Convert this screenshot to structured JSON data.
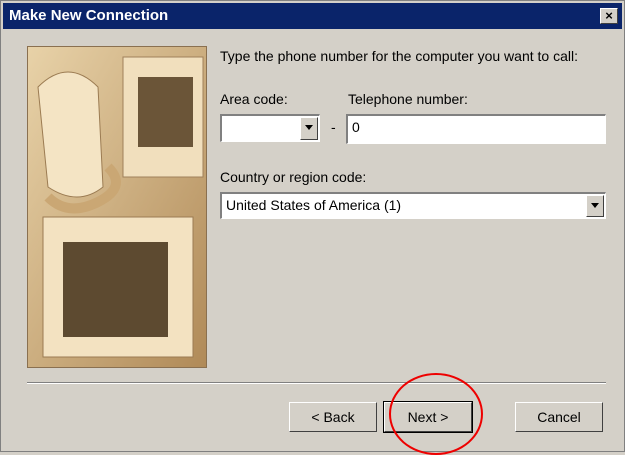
{
  "window": {
    "title": "Make New Connection"
  },
  "instructions": "Type the phone number for the computer you want to call:",
  "area_code": {
    "label": "Area code:",
    "value": ""
  },
  "separator_dash": "-",
  "phone": {
    "label": "Telephone number:",
    "value": "0"
  },
  "country": {
    "label": "Country or region code:",
    "value": "United States of America (1)"
  },
  "buttons": {
    "back": "< Back",
    "next": "Next >",
    "cancel": "Cancel"
  },
  "colors": {
    "titlebar": "#0a246a",
    "face": "#d4d0c8",
    "annotation": "#e00000"
  }
}
